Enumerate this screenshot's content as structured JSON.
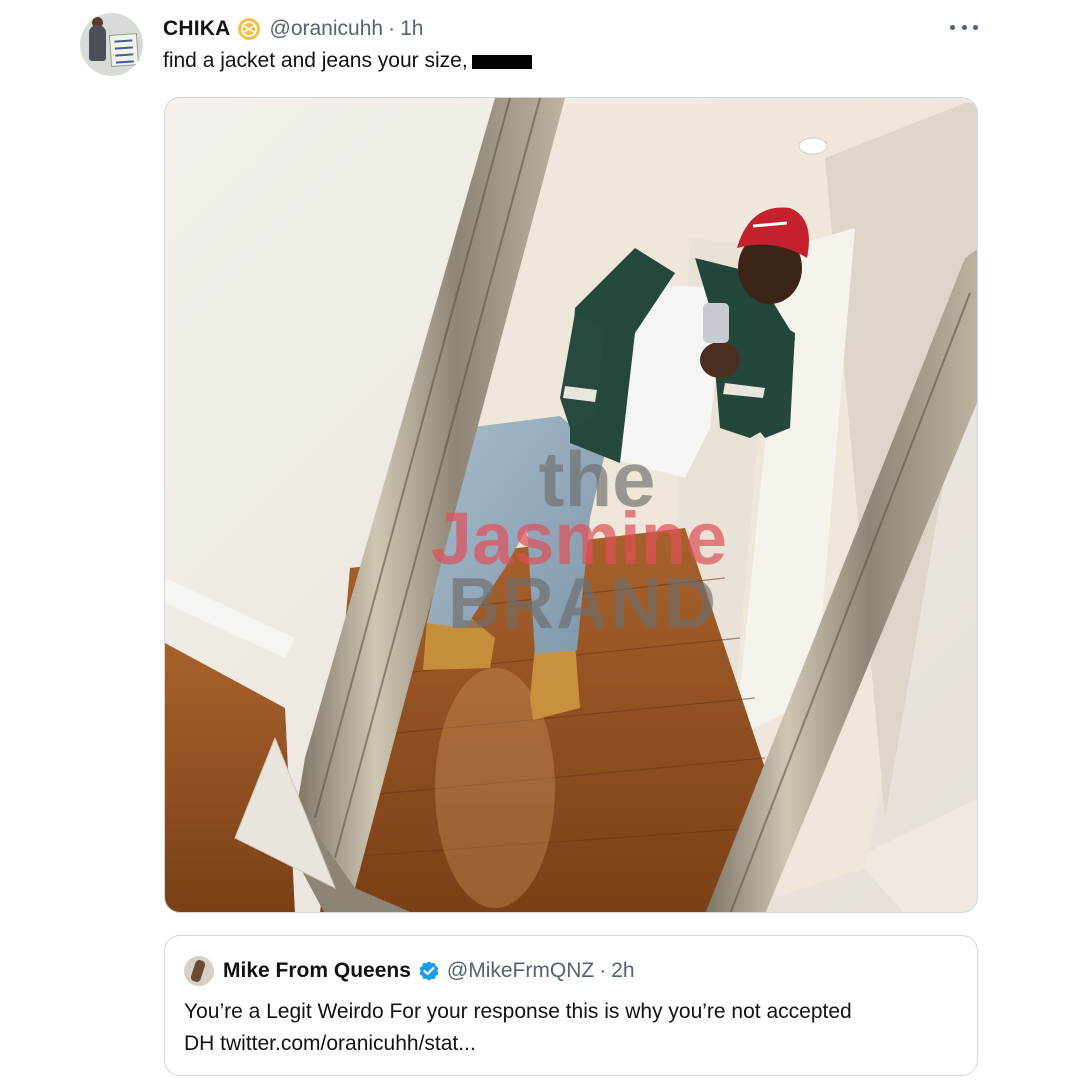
{
  "tweet": {
    "author_name": "CHIKA",
    "author_handle": "@oranicuhh",
    "separator": "·",
    "time": "1h",
    "text": "find a jacket and jeans your size,",
    "avatar_sign_text": "CHIKA",
    "badge_icon": "gold-badge-icon",
    "more_icon": "more-icon"
  },
  "media": {
    "alt": "Man in red cap, green varsity jacket, white shirt, jeans and tan boots taking a mirror selfie",
    "watermark": {
      "line1": "the",
      "line2": "Jasmine",
      "line3": "BRAND"
    }
  },
  "quote": {
    "author_name": "Mike From Queens",
    "author_handle": "@MikeFrmQNZ",
    "separator": "·",
    "time": "2h",
    "line1": "You’re a Legit Weirdo For your response this is why you’re not accepted",
    "line2": "DH twitter.com/oranicuhh/stat...",
    "verified_icon": "verified-icon"
  },
  "colors": {
    "text_primary": "#0f1419",
    "text_secondary": "#536471",
    "verified_blue": "#1d9bf0",
    "badge_gold": "#f3c24a",
    "border": "#cfd9de",
    "watermark_red": "#e0505a",
    "watermark_gray": "#6d6d6d"
  }
}
